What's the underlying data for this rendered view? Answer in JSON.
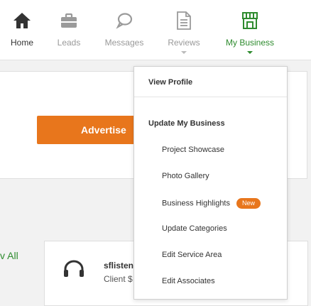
{
  "nav": {
    "items": [
      {
        "label": "Home",
        "icon": "home-icon"
      },
      {
        "label": "Leads",
        "icon": "briefcase-icon"
      },
      {
        "label": "Messages",
        "icon": "chat-bubble-icon"
      },
      {
        "label": "Reviews",
        "icon": "document-icon"
      },
      {
        "label": "My Business",
        "icon": "storefront-icon"
      }
    ],
    "active": "My Business"
  },
  "main": {
    "advertise_label": "Advertise",
    "view_all_label": "v All",
    "contact": {
      "name": "sflisten",
      "role": "Client $"
    }
  },
  "dropdown": {
    "view_profile": "View Profile",
    "update_business": "Update My Business",
    "items": [
      {
        "label": "Project Showcase"
      },
      {
        "label": "Photo Gallery"
      },
      {
        "label": "Business Highlights",
        "badge": "New"
      },
      {
        "label": "Update Categories"
      },
      {
        "label": "Edit Service Area"
      },
      {
        "label": "Edit Associates"
      }
    ]
  },
  "colors": {
    "accent_green": "#2e8b2e",
    "accent_orange": "#e8761c",
    "icon_dark": "#333333",
    "icon_grey": "#9a9a9a"
  }
}
